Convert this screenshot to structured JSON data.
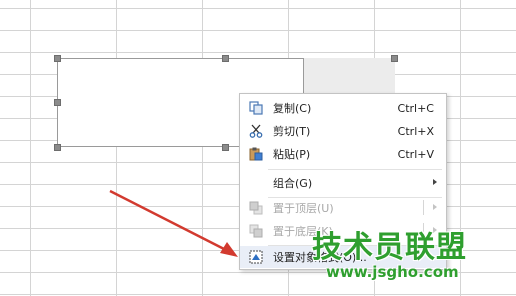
{
  "context_menu": {
    "items": [
      {
        "label": "复制(C)",
        "shortcut": "Ctrl+C",
        "icon": "copy-icon",
        "disabled": false
      },
      {
        "label": "剪切(T)",
        "shortcut": "Ctrl+X",
        "icon": "cut-icon",
        "disabled": false
      },
      {
        "label": "粘贴(P)",
        "shortcut": "Ctrl+V",
        "icon": "paste-icon",
        "disabled": false
      },
      {
        "label": "组合(G)",
        "shortcut": "",
        "icon": "",
        "disabled": false,
        "submenu": true
      },
      {
        "label": "置于顶层(U)",
        "shortcut": "",
        "icon": "bring-to-front-icon",
        "disabled": true,
        "submenu": true
      },
      {
        "label": "置于底层(K)",
        "shortcut": "",
        "icon": "send-to-back-icon",
        "disabled": true,
        "submenu": true
      },
      {
        "label": "设置对象格式(O)...",
        "shortcut": "",
        "icon": "format-object-icon",
        "disabled": false,
        "highlighted": true
      }
    ]
  },
  "watermark": {
    "text": "技术员联盟",
    "url": "www.jsgho.com"
  },
  "colors": {
    "arrow": "#d23a2f",
    "watermark": "#2f9f2f",
    "grid": "#d4d4d4"
  }
}
